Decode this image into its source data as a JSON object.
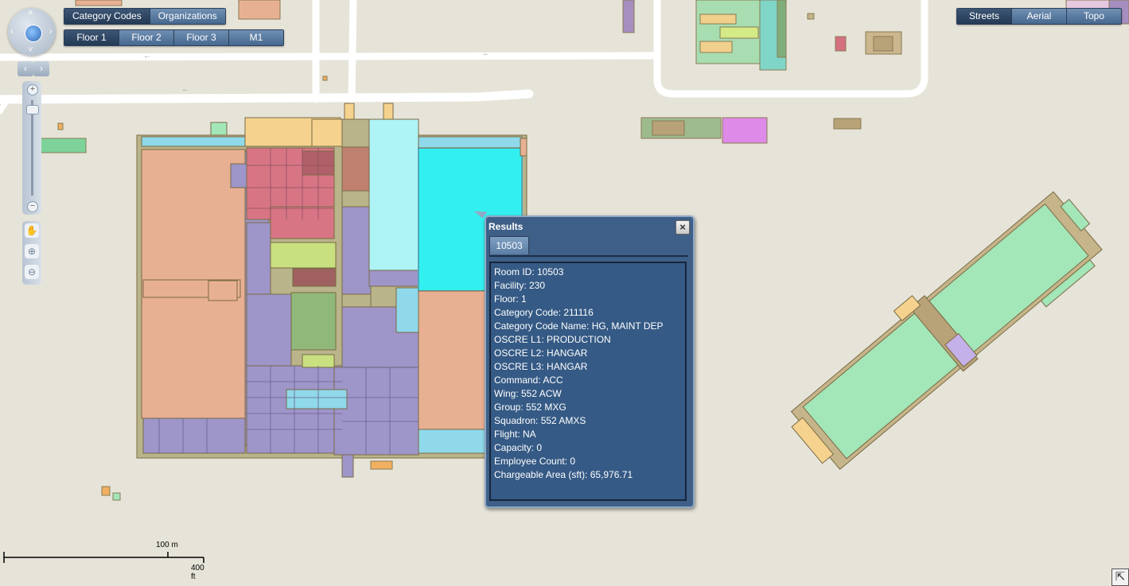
{
  "toolbar": {
    "layer_tabs": [
      {
        "label": "Category Codes",
        "active": true
      },
      {
        "label": "Organizations",
        "active": false
      }
    ],
    "floor_tabs": [
      {
        "label": "Floor 1",
        "active": true
      },
      {
        "label": "Floor 2",
        "active": false
      },
      {
        "label": "Floor 3",
        "active": false
      },
      {
        "label": "M1",
        "active": false
      }
    ],
    "basemap_tabs": [
      {
        "label": "Streets",
        "active": true
      },
      {
        "label": "Aerial",
        "active": false
      },
      {
        "label": "Topo",
        "active": false
      }
    ]
  },
  "nav": {
    "pan_icon": "globe-icon",
    "zoom_in": "+",
    "zoom_out": "−",
    "tools": [
      "hand-icon",
      "zoom-in-icon",
      "zoom-out-icon"
    ]
  },
  "popup": {
    "title": "Results",
    "tab_label": "10503",
    "lines": [
      "Room ID: 10503",
      "Facility: 230",
      "Floor: 1",
      "Category Code: 211116",
      "Category Code Name: HG, MAINT DEP",
      "OSCRE L1: PRODUCTION",
      "OSCRE L2: HANGAR",
      "OSCRE L3: HANGAR",
      "Command: ACC",
      "Wing: 552 ACW",
      "Group: 552 MXG",
      "Squadron: 552 AMXS",
      "Flight: NA",
      "Capacity: 0",
      "Employee Count: 0",
      "Chargeable Area (sft): 65,976.71"
    ]
  },
  "scale": {
    "metric_label": "100 m",
    "imperial_label": "400 ft"
  },
  "colors": {
    "ui_blue": "#47688f",
    "ui_active": "#243a55",
    "hangar_orange": "#e8b092",
    "admin_purple": "#9e95c9",
    "shop_red": "#d87585",
    "selected_cyan": "#33f0f0",
    "open_green": "#a3e6b8"
  }
}
